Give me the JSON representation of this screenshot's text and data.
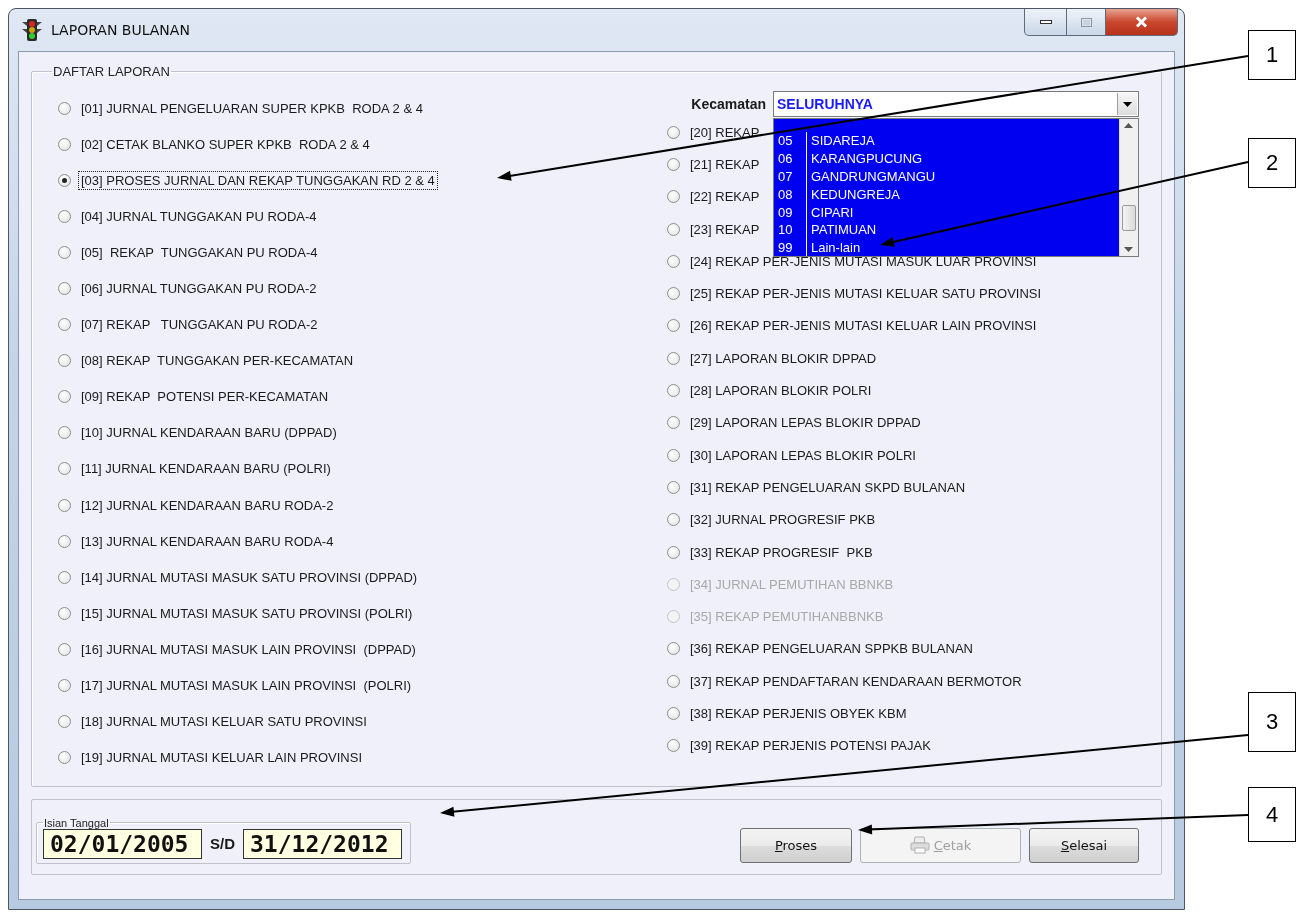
{
  "window": {
    "title": "LAPORAN BULANAN"
  },
  "report_group": {
    "title": "DAFTAR LAPORAN",
    "left_column": [
      {
        "label": "[01] JURNAL PENGELUARAN SUPER KPKB  RODA 2 & 4",
        "selected": false,
        "disabled": false
      },
      {
        "label": "[02] CETAK BLANKO SUPER KPKB  RODA 2 & 4",
        "selected": false,
        "disabled": false
      },
      {
        "label": "[03] PROSES JURNAL DAN REKAP TUNGGAKAN RD 2 & 4",
        "selected": true,
        "disabled": false
      },
      {
        "label": "[04] JURNAL TUNGGAKAN PU RODA-4",
        "selected": false,
        "disabled": false
      },
      {
        "label": "[05]  REKAP  TUNGGAKAN PU RODA-4",
        "selected": false,
        "disabled": false
      },
      {
        "label": "[06] JURNAL TUNGGAKAN PU RODA-2",
        "selected": false,
        "disabled": false
      },
      {
        "label": "[07] REKAP   TUNGGAKAN PU RODA-2",
        "selected": false,
        "disabled": false
      },
      {
        "label": "[08] REKAP  TUNGGAKAN PER-KECAMATAN",
        "selected": false,
        "disabled": false
      },
      {
        "label": "[09] REKAP  POTENSI PER-KECAMATAN",
        "selected": false,
        "disabled": false
      },
      {
        "label": "[10] JURNAL KENDARAAN BARU (DPPAD)",
        "selected": false,
        "disabled": false
      },
      {
        "label": "[11] JURNAL KENDARAAN BARU (POLRI)",
        "selected": false,
        "disabled": false
      },
      {
        "label": "[12] JURNAL KENDARAAN BARU RODA-2",
        "selected": false,
        "disabled": false
      },
      {
        "label": "[13] JURNAL KENDARAAN BARU RODA-4",
        "selected": false,
        "disabled": false
      },
      {
        "label": "[14] JURNAL MUTASI MASUK SATU PROVINSI (DPPAD)",
        "selected": false,
        "disabled": false
      },
      {
        "label": "[15] JURNAL MUTASI MASUK SATU PROVINSI (POLRI)",
        "selected": false,
        "disabled": false
      },
      {
        "label": "[16] JURNAL MUTASI MASUK LAIN PROVINSI  (DPPAD)",
        "selected": false,
        "disabled": false
      },
      {
        "label": "[17] JURNAL MUTASI MASUK LAIN PROVINSI  (POLRI)",
        "selected": false,
        "disabled": false
      },
      {
        "label": "[18] JURNAL MUTASI KELUAR SATU PROVINSI",
        "selected": false,
        "disabled": false
      },
      {
        "label": "[19] JURNAL MUTASI KELUAR LAIN PROVINSI",
        "selected": false,
        "disabled": false
      }
    ],
    "right_column": [
      {
        "label": "[20] REKAP",
        "selected": false,
        "disabled": false
      },
      {
        "label": "[21] REKAP",
        "selected": false,
        "disabled": false
      },
      {
        "label": "[22] REKAP",
        "selected": false,
        "disabled": false
      },
      {
        "label": "[23] REKAP",
        "selected": false,
        "disabled": false
      },
      {
        "label": "[24] REKAP PER-JENIS MUTASI MASUK LUAR PROVINSI",
        "selected": false,
        "disabled": false
      },
      {
        "label": "[25] REKAP PER-JENIS MUTASI KELUAR SATU PROVINSI",
        "selected": false,
        "disabled": false
      },
      {
        "label": "[26] REKAP PER-JENIS MUTASI KELUAR LAIN PROVINSI",
        "selected": false,
        "disabled": false
      },
      {
        "label": "[27] LAPORAN BLOKIR DPPAD",
        "selected": false,
        "disabled": false
      },
      {
        "label": "[28] LAPORAN BLOKIR POLRI",
        "selected": false,
        "disabled": false
      },
      {
        "label": "[29] LAPORAN LEPAS BLOKIR DPPAD",
        "selected": false,
        "disabled": false
      },
      {
        "label": "[30] LAPORAN LEPAS BLOKIR POLRI",
        "selected": false,
        "disabled": false
      },
      {
        "label": "[31] REKAP PENGELUARAN SKPD BULANAN",
        "selected": false,
        "disabled": false
      },
      {
        "label": "[32] JURNAL PROGRESIF PKB",
        "selected": false,
        "disabled": false
      },
      {
        "label": "[33] REKAP PROGRESIF  PKB",
        "selected": false,
        "disabled": false
      },
      {
        "label": "[34] JURNAL PEMUTIHAN BBNKB",
        "selected": false,
        "disabled": true
      },
      {
        "label": "[35] REKAP PEMUTIHANBBNKB",
        "selected": false,
        "disabled": true
      },
      {
        "label": "[36] REKAP PENGELUARAN SPPKB BULANAN",
        "selected": false,
        "disabled": false
      },
      {
        "label": "[37] REKAP PENDAFTARAN KENDARAAN BERMOTOR",
        "selected": false,
        "disabled": false
      },
      {
        "label": "[38] REKAP PERJENIS OBYEK KBM",
        "selected": false,
        "disabled": false
      },
      {
        "label": "[39] REKAP PERJENIS POTENSI PAJAK",
        "selected": false,
        "disabled": false
      }
    ],
    "kecamatan": {
      "label": "Kecamatan",
      "value": "SELURUHNYA",
      "options": [
        {
          "code": "05",
          "name": "SIDAREJA"
        },
        {
          "code": "06",
          "name": "KARANGPUCUNG"
        },
        {
          "code": "07",
          "name": "GANDRUNGMANGU"
        },
        {
          "code": "08",
          "name": "KEDUNGREJA"
        },
        {
          "code": "09",
          "name": "CIPARI"
        },
        {
          "code": "10",
          "name": "PATIMUAN"
        },
        {
          "code": "99",
          "name": "Lain-lain"
        }
      ]
    }
  },
  "date_group": {
    "title": "Isian Tanggal",
    "from": "02/01/2005",
    "separator": "S/D",
    "to": "31/12/2012"
  },
  "buttons": [
    {
      "label": "Proses",
      "kind": "plain",
      "disabled": false
    },
    {
      "label": "Cetak",
      "kind": "print",
      "disabled": true
    },
    {
      "label": "Selesai",
      "kind": "plain",
      "disabled": false
    }
  ],
  "annotations": [
    {
      "number": "1"
    },
    {
      "number": "2"
    },
    {
      "number": "3"
    },
    {
      "number": "4"
    }
  ]
}
